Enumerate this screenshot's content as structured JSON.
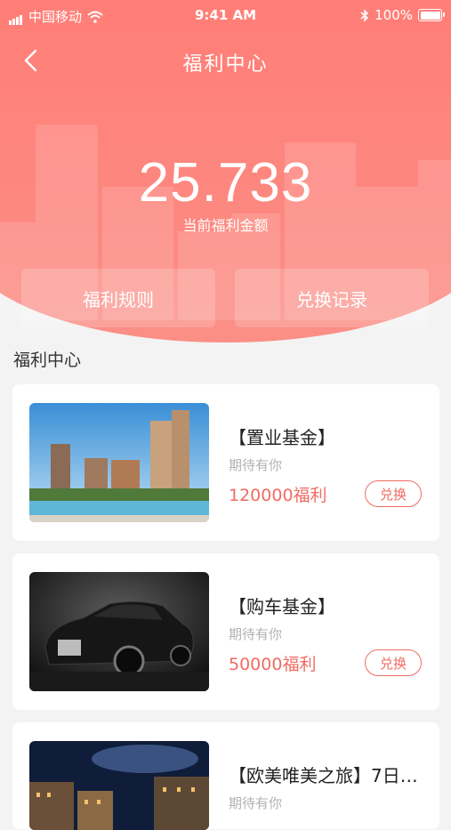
{
  "status_bar": {
    "carrier": "中国移动",
    "time": "9:41 AM",
    "battery": "100%",
    "icons": [
      "signal-icon",
      "wifi-icon",
      "bluetooth-icon",
      "battery-icon"
    ]
  },
  "nav": {
    "title": "福利中心",
    "back_icon": "chevron-left-icon"
  },
  "summary": {
    "amount": "25.733",
    "amount_label": "当前福利金额",
    "rules_label": "福利规则",
    "record_label": "兑换记录"
  },
  "section": {
    "title": "福利中心"
  },
  "items": [
    {
      "name": "【置业基金】",
      "subtitle": "期待有你",
      "price": "120000福利",
      "action": "兑换",
      "image": "apartment-buildings-pool-image"
    },
    {
      "name": "【购车基金】",
      "subtitle": "期待有你",
      "price": "50000福利",
      "action": "兑换",
      "image": "black-luxury-car-image"
    },
    {
      "name": "【欧美唯美之旅】7日…",
      "subtitle": "期待有你",
      "price": "",
      "action": "",
      "image": "european-town-night-image"
    }
  ],
  "colors": {
    "header": "#ff7a74",
    "accent": "#f06b63",
    "background": "#f3f3f3"
  }
}
